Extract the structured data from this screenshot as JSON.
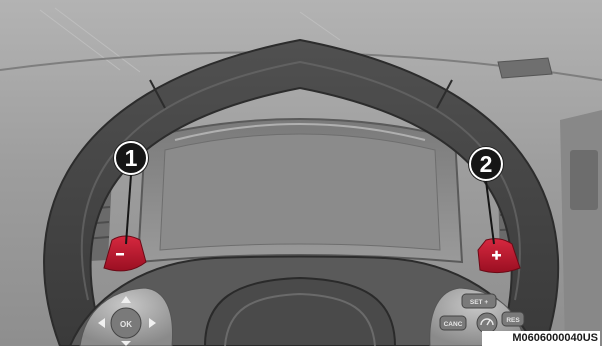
{
  "illustration": {
    "subject": "steering wheel with paddle shifters",
    "colors": {
      "paddle": "#c0182e",
      "callout": "#161616",
      "background": "#9a9a9a"
    }
  },
  "callouts": [
    {
      "number": "1"
    },
    {
      "number": "2"
    }
  ],
  "paddles": {
    "left_symbol": "−",
    "right_symbol": "+"
  },
  "controls": {
    "left_pad": {
      "ok_label": "OK"
    },
    "right_pad": {
      "set_label": "SET +",
      "canc_label": "CANC",
      "res_label": "RES"
    }
  },
  "figure_code": "M0606000040US"
}
